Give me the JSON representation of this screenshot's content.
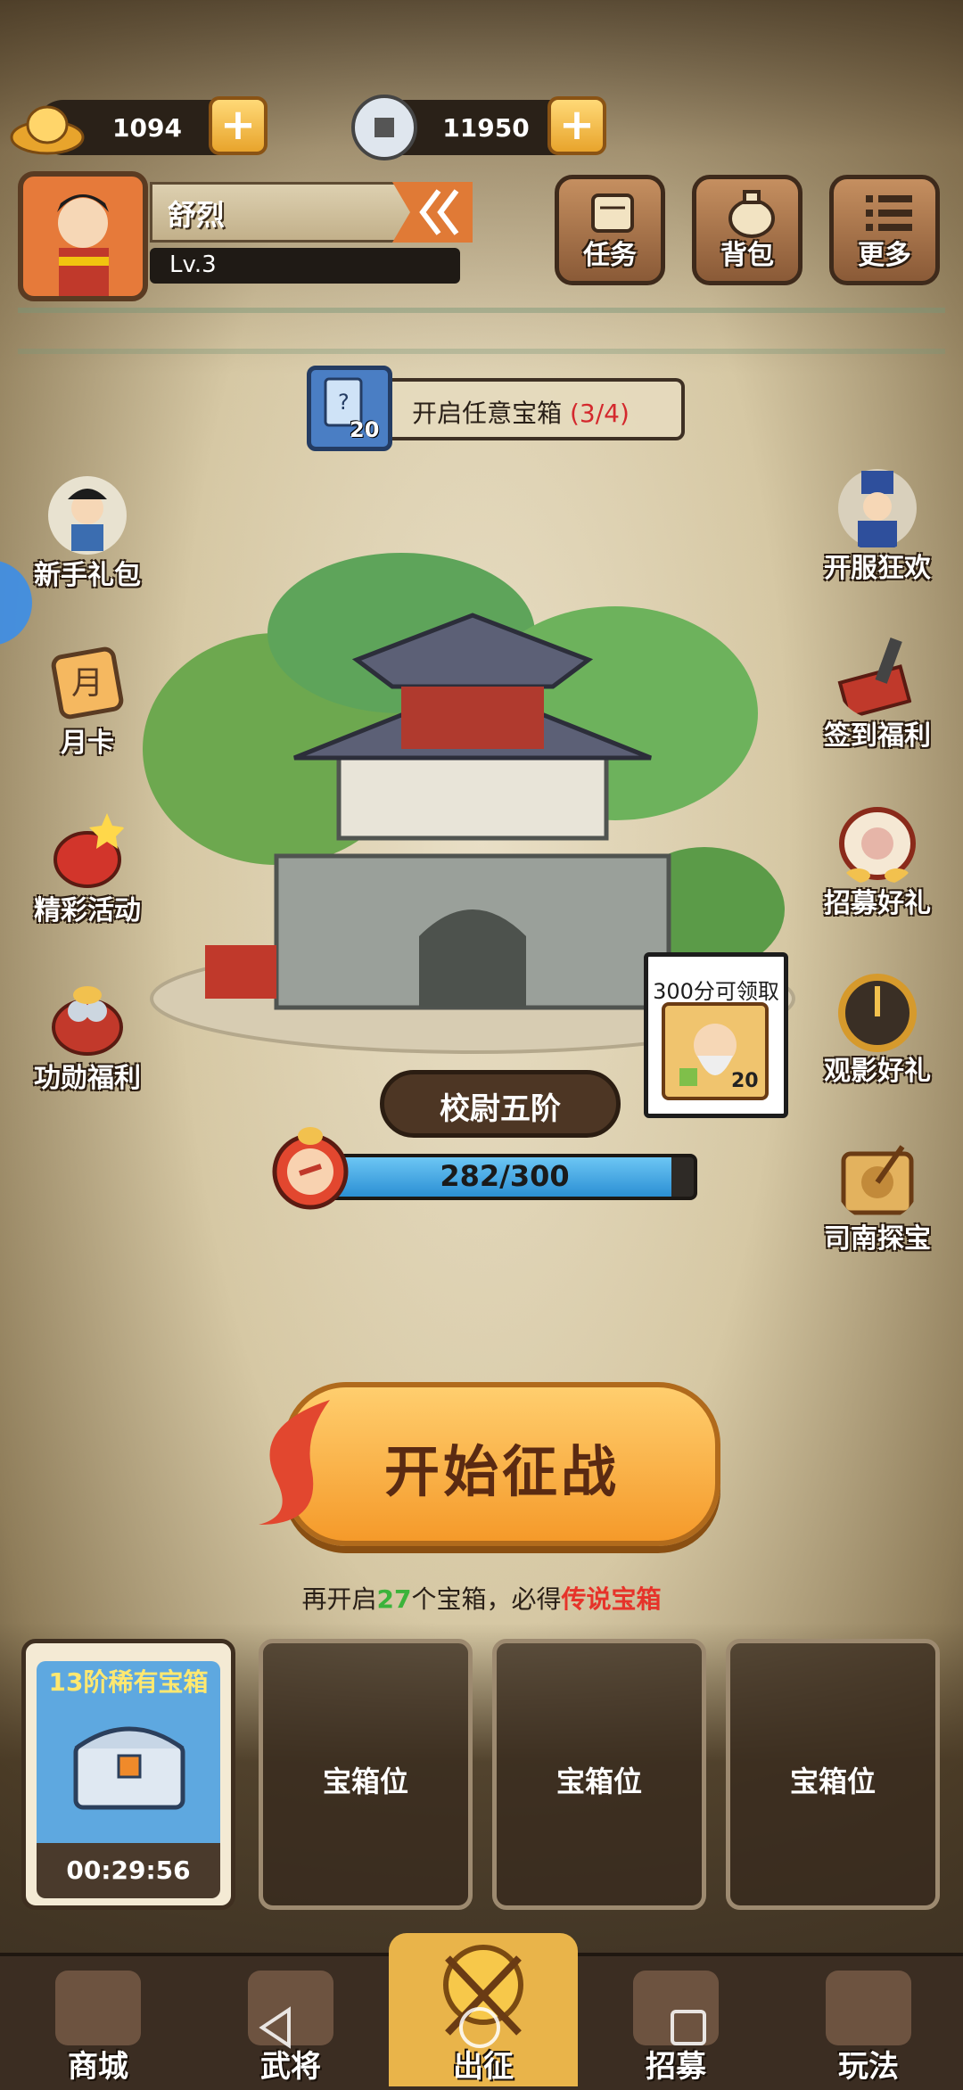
{
  "currency": {
    "gold": "1094",
    "coins": "11950"
  },
  "player": {
    "name": "舒烈",
    "level": "Lv.3"
  },
  "top_buttons": {
    "tasks": "任务",
    "bag": "背包",
    "more": "更多"
  },
  "quest": {
    "icon_count": "20",
    "text": "开启任意宝箱",
    "progress": "(3/4)"
  },
  "left_features": [
    "新手礼包",
    "月卡",
    "精彩活动",
    "功勋福利"
  ],
  "right_features": [
    "开服狂欢",
    "签到福利",
    "招募好礼",
    "观影好礼",
    "司南探宝"
  ],
  "rank": {
    "title": "校尉五阶",
    "progress_text": "282/300",
    "progress_fraction": 0.94
  },
  "reward_bubble": {
    "text": "300分可领取",
    "count": "20"
  },
  "start_button": "开始征战",
  "hint": {
    "prefix": "再开启",
    "count": "27",
    "middle": "个宝箱，必得",
    "highlight": "传说宝箱"
  },
  "chest_slots": {
    "active_title": "13阶稀有宝箱",
    "active_timer": "00:29:56",
    "empty_label": "宝箱位"
  },
  "bottom_nav": [
    "商城",
    "武将",
    "出征",
    "招募",
    "玩法"
  ],
  "colors": {
    "accent_orange": "#f59a2a",
    "progress_blue": "#2b8fd4",
    "red_text": "#d4292d",
    "green_text": "#3bb33b"
  }
}
